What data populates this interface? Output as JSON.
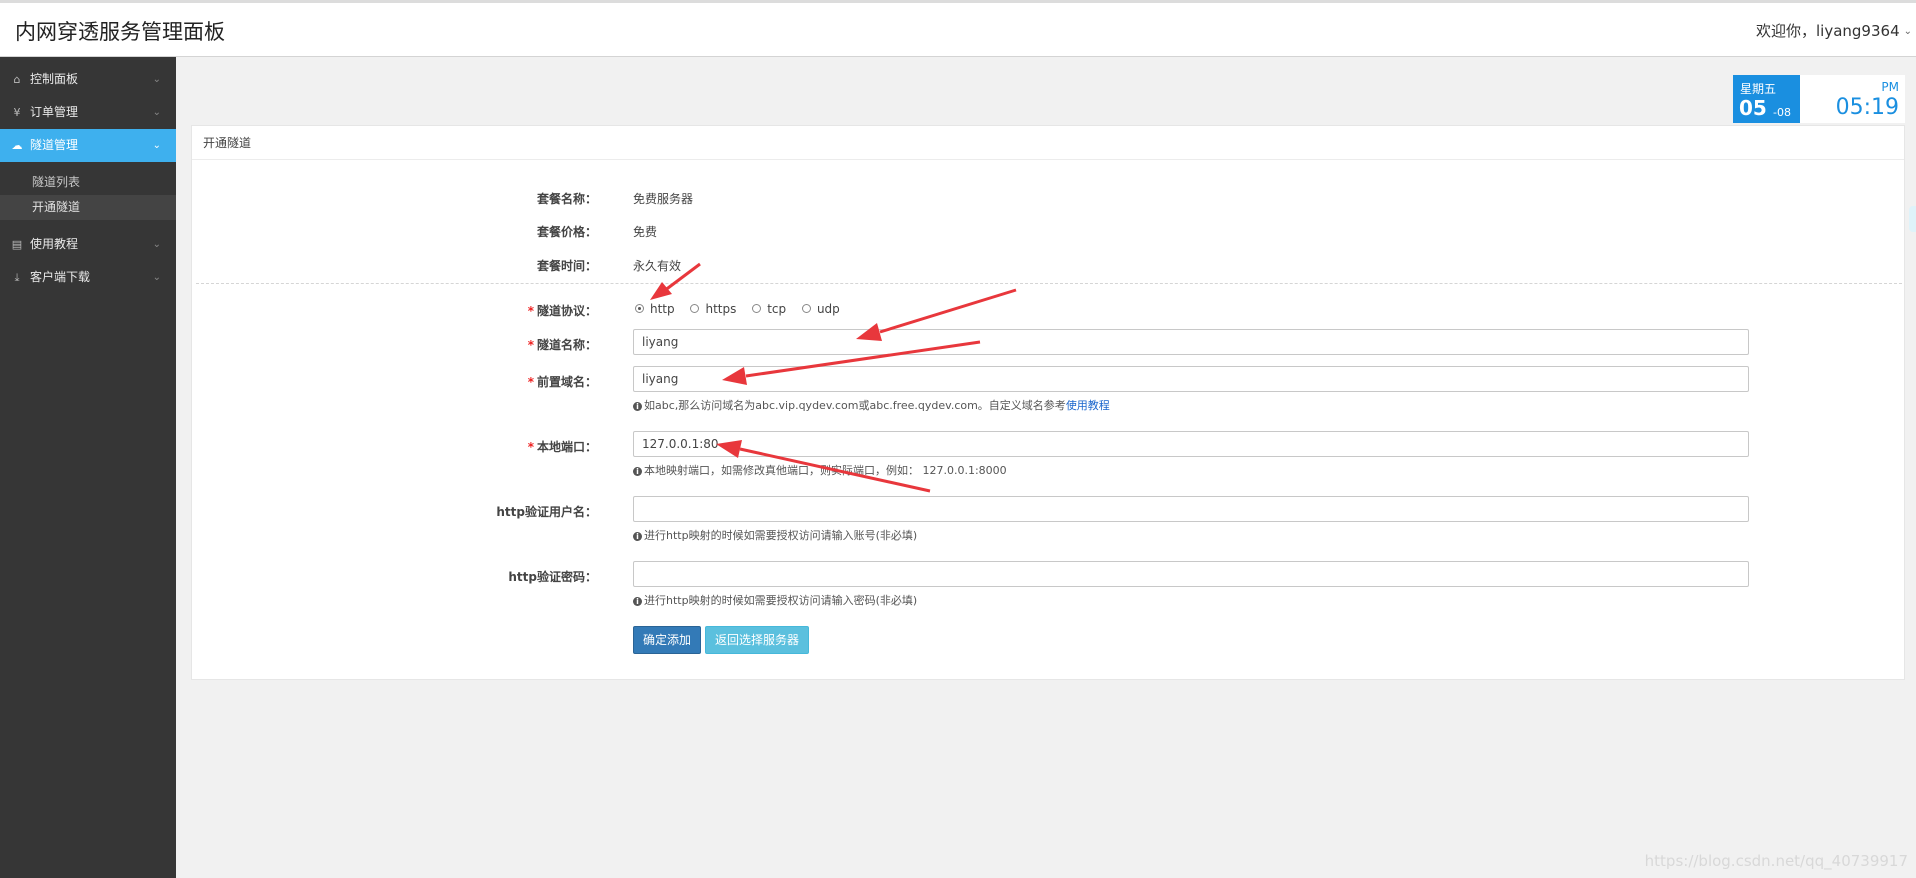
{
  "app": {
    "title": "内网穿透服务管理面板"
  },
  "user": {
    "greeting": "欢迎你，liyang9364",
    "chevron": "chevron-down-icon"
  },
  "sidebar": {
    "items": [
      {
        "label": "控制面板",
        "icon": "home-icon"
      },
      {
        "label": "订单管理",
        "icon": "yen-icon"
      },
      {
        "label": "隧道管理",
        "icon": "cloud-icon",
        "active": true
      },
      {
        "label": "使用教程",
        "icon": "book-icon"
      },
      {
        "label": "客户端下载",
        "icon": "download-icon"
      }
    ],
    "sub_items": [
      {
        "label": "隧道列表"
      },
      {
        "label": "开通隧道",
        "current": true
      }
    ]
  },
  "clock": {
    "weekday": "星期五",
    "date": "05",
    "month": "-08",
    "ampm": "PM",
    "time": "05:19",
    "accent": "#1a8fe0"
  },
  "panel": {
    "title": "开通隧道"
  },
  "plan": {
    "name_label": "套餐名称：",
    "name_value": "免费服务器",
    "price_label": "套餐价格：",
    "price_value": "免费",
    "time_label": "套餐时间：",
    "time_value": "永久有效"
  },
  "form": {
    "required_mark": "*",
    "protocol": {
      "label": "隧道协议：",
      "options": [
        "http",
        "https",
        "tcp",
        "udp"
      ],
      "selected": "http"
    },
    "tunnel_name": {
      "label": "隧道名称：",
      "value": "liyang"
    },
    "domain": {
      "label": "前置域名：",
      "value": "liyang",
      "help_icon": "info-icon",
      "help": "如abc,那么访问域名为abc.vip.qydev.com或abc.free.qydev.com。自定义域名参考",
      "help_link": "使用教程"
    },
    "local_port": {
      "label": "本地端口：",
      "value": "127.0.0.1:80",
      "help_icon": "info-icon",
      "help": "本地映射端口，如需修改真他端口，则实际端口，例如： 127.0.0.1:8000"
    },
    "auth_user": {
      "label": "http验证用户名：",
      "value": "",
      "help_icon": "info-icon",
      "help": "进行http映射的时候如需要授权访问请输入账号(非必填)"
    },
    "auth_pass": {
      "label": "http验证密码：",
      "value": "",
      "help_icon": "info-icon",
      "help": "进行http映射的时候如需要授权访问请输入密码(非必填)"
    },
    "submit_label": "确定添加",
    "back_label": "返回选择服务器"
  },
  "colors": {
    "sidebar_bg": "#363636",
    "active_nav": "#3eb0ee",
    "primary_btn": "#337ab7",
    "info_btn": "#5bc0de",
    "required": "#e22222",
    "annotation_arrow": "#e8373c"
  },
  "watermark": "https://blog.csdn.net/qq_40739917"
}
